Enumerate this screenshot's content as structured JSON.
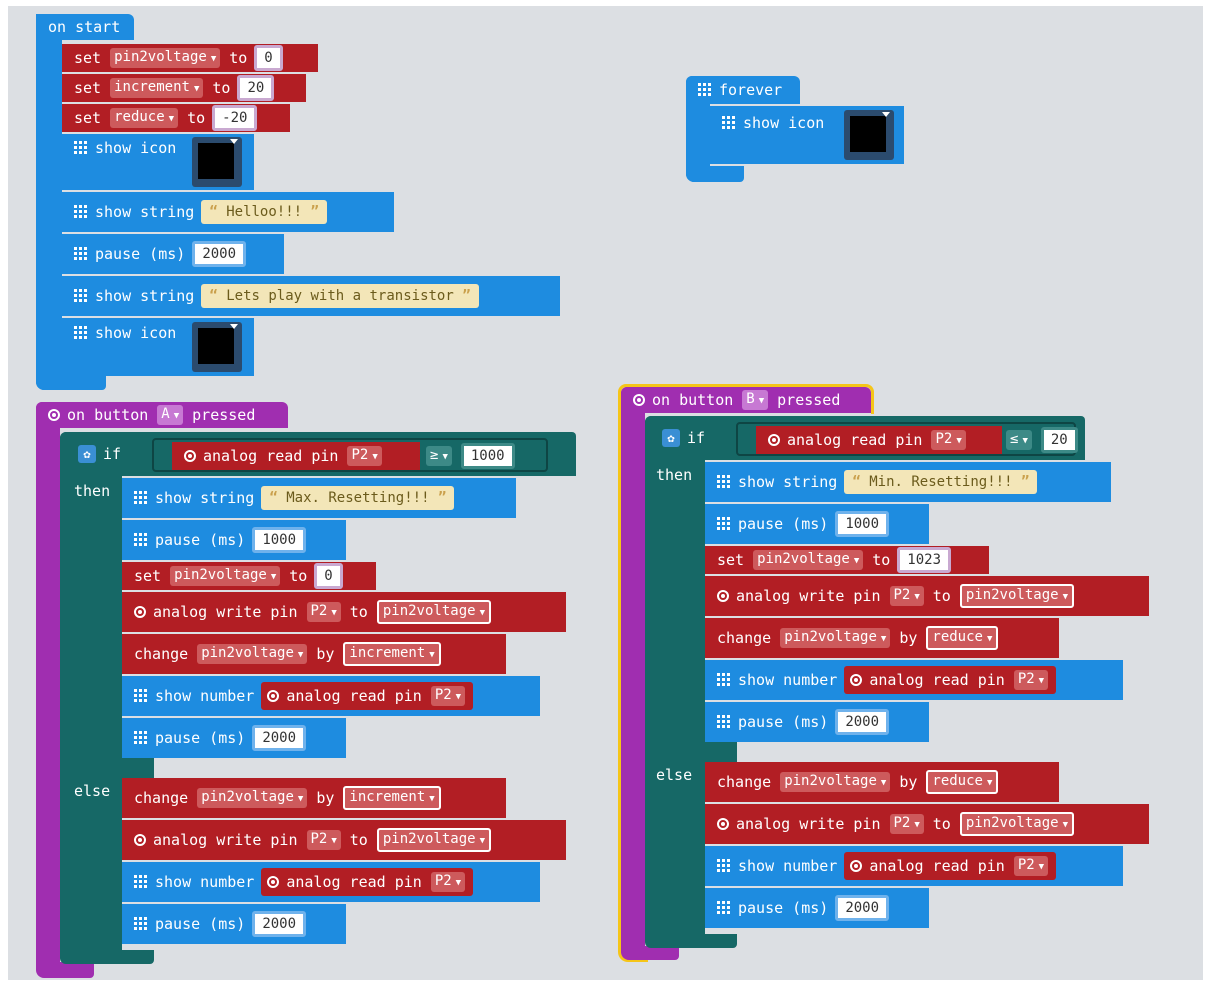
{
  "on_start": {
    "header": "on start",
    "set1": {
      "kw": "set",
      "var": "pin2voltage",
      "to": "to",
      "val": "0"
    },
    "set2": {
      "kw": "set",
      "var": "increment",
      "to": "to",
      "val": "20"
    },
    "set3": {
      "kw": "set",
      "var": "reduce",
      "to": "to",
      "val": "-20"
    },
    "show_icon_1": "show icon",
    "show_string_1": {
      "label": "show string",
      "text": "Helloo!!!"
    },
    "pause_1": {
      "label": "pause (ms)",
      "val": "2000"
    },
    "show_string_2": {
      "label": "show string",
      "text": "Lets play with a transistor"
    },
    "show_icon_2": "show icon"
  },
  "forever": {
    "header": "forever",
    "show_icon": "show icon"
  },
  "button_a": {
    "on": "on button",
    "btn": "A",
    "pressed": "pressed",
    "if": "if",
    "cond": {
      "label": "analog read pin",
      "pin": "P2",
      "op": "≥",
      "val": "1000"
    },
    "then": "then",
    "else": "else",
    "then_blocks": {
      "show_string": {
        "label": "show string",
        "text": "Max. Resetting!!!"
      },
      "pause_1": {
        "label": "pause (ms)",
        "val": "1000"
      },
      "set": {
        "kw": "set",
        "var": "pin2voltage",
        "to": "to",
        "val": "0"
      },
      "write": {
        "label": "analog write pin",
        "pin": "P2",
        "to": "to",
        "var": "pin2voltage"
      },
      "change": {
        "kw": "change",
        "var": "pin2voltage",
        "by": "by",
        "amt": "increment"
      },
      "show_number": {
        "label": "show number",
        "read": "analog read pin",
        "pin": "P2"
      },
      "pause_2": {
        "label": "pause (ms)",
        "val": "2000"
      }
    },
    "else_blocks": {
      "change": {
        "kw": "change",
        "var": "pin2voltage",
        "by": "by",
        "amt": "increment"
      },
      "write": {
        "label": "analog write pin",
        "pin": "P2",
        "to": "to",
        "var": "pin2voltage"
      },
      "show_number": {
        "label": "show number",
        "read": "analog read pin",
        "pin": "P2"
      },
      "pause": {
        "label": "pause (ms)",
        "val": "2000"
      }
    }
  },
  "button_b": {
    "on": "on button",
    "btn": "B",
    "pressed": "pressed",
    "if": "if",
    "cond": {
      "label": "analog read pin",
      "pin": "P2",
      "op": "≤",
      "val": "20"
    },
    "then": "then",
    "else": "else",
    "then_blocks": {
      "show_string": {
        "label": "show string",
        "text": "Min. Resetting!!!"
      },
      "pause_1": {
        "label": "pause (ms)",
        "val": "1000"
      },
      "set": {
        "kw": "set",
        "var": "pin2voltage",
        "to": "to",
        "val": "1023"
      },
      "write": {
        "label": "analog write pin",
        "pin": "P2",
        "to": "to",
        "var": "pin2voltage"
      },
      "change": {
        "kw": "change",
        "var": "pin2voltage",
        "by": "by",
        "amt": "reduce"
      },
      "show_number": {
        "label": "show number",
        "read": "analog read pin",
        "pin": "P2"
      },
      "pause_2": {
        "label": "pause (ms)",
        "val": "2000"
      }
    },
    "else_blocks": {
      "change": {
        "kw": "change",
        "var": "pin2voltage",
        "by": "by",
        "amt": "reduce"
      },
      "write": {
        "label": "analog write pin",
        "pin": "P2",
        "to": "to",
        "var": "pin2voltage"
      },
      "show_number": {
        "label": "show number",
        "read": "analog read pin",
        "pin": "P2"
      },
      "pause": {
        "label": "pause (ms)",
        "val": "2000"
      }
    }
  },
  "colors": {
    "basic": "#1e8ce0",
    "variables": "#b21e24",
    "logic": "#166866",
    "input": "#a02eb0",
    "selected_outline": "#f5c518"
  }
}
